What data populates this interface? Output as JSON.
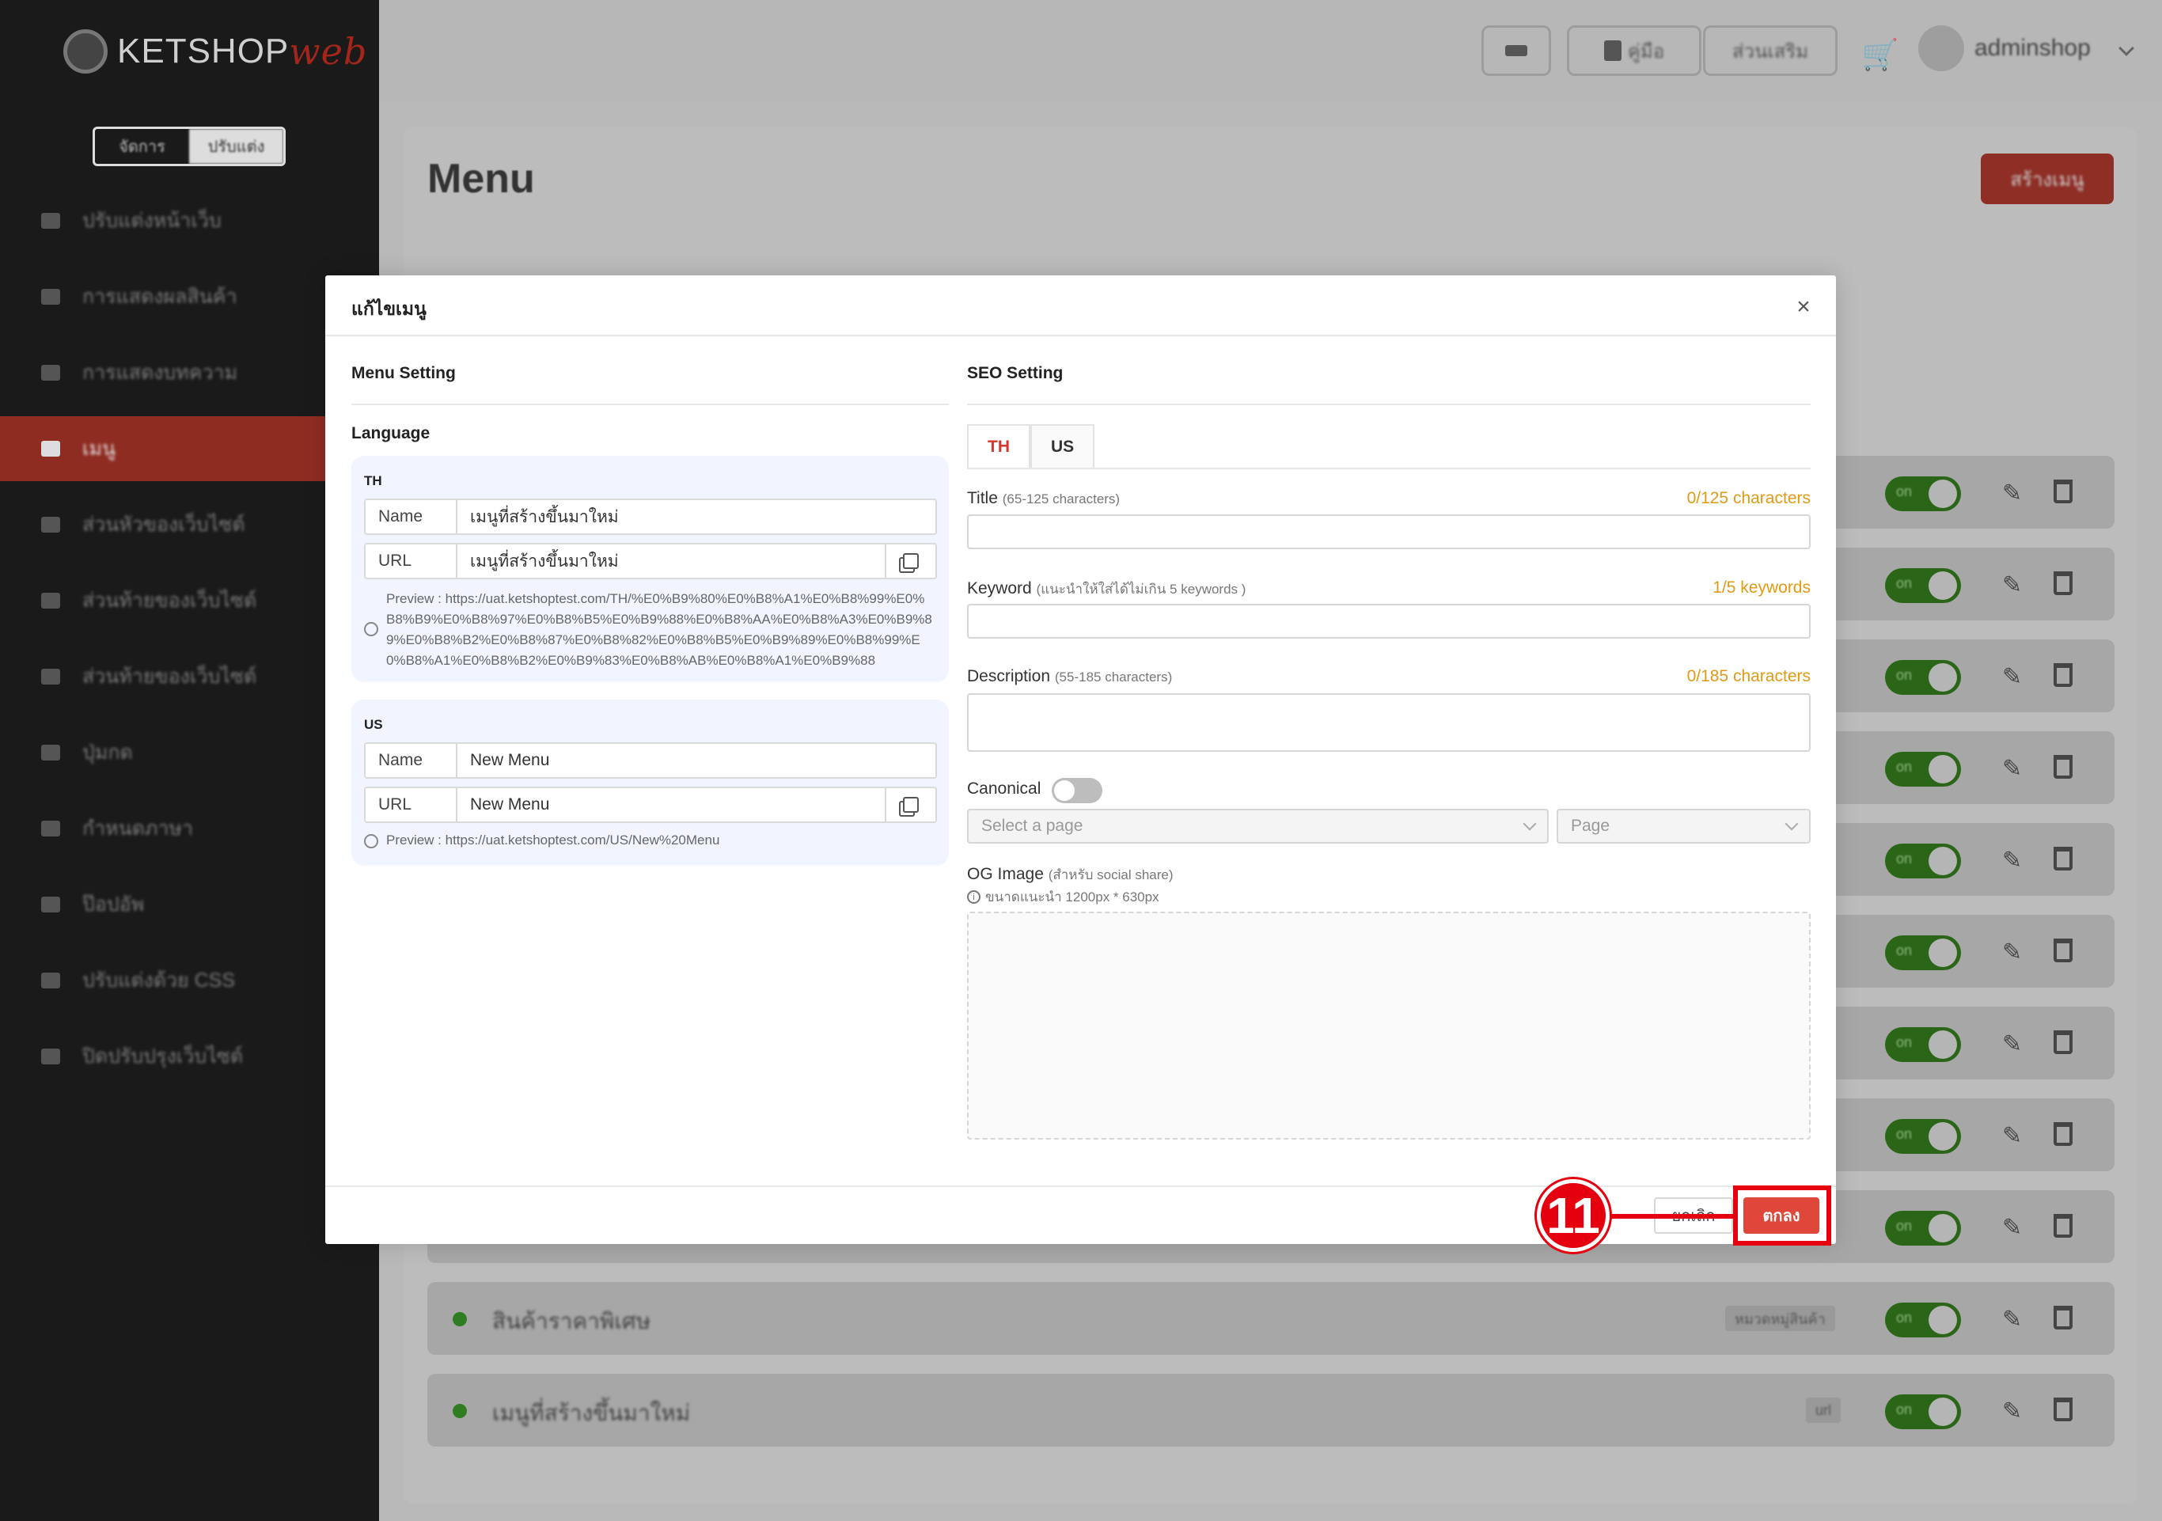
{
  "app": {
    "logo_text": "KETSHOP",
    "logo_suffix": "web"
  },
  "mode_switch": {
    "left": "จัดการ",
    "right": "ปรับแต่ง"
  },
  "sidebar": {
    "items": [
      {
        "label": "ปรับแต่งหน้าเว็บ",
        "icon": "layout-icon"
      },
      {
        "label": "การแสดงผลสินค้า",
        "icon": "product-grid-icon"
      },
      {
        "label": "การแสดงบทความ",
        "icon": "article-icon"
      },
      {
        "label": "เมนู",
        "icon": "menu-icon",
        "active": true
      },
      {
        "label": "ส่วนหัวของเว็บไซต์",
        "icon": "header-icon"
      },
      {
        "label": "ส่วนท้ายของเว็บไซต์",
        "icon": "footer-icon"
      },
      {
        "label": "ส่วนท้ายของเว็บไซต์",
        "icon": "sidebar-icon"
      },
      {
        "label": "ปุ่มกด",
        "icon": "button-icon"
      },
      {
        "label": "กำหนดภาษา",
        "icon": "language-icon"
      },
      {
        "label": "ป๊อปอัพ",
        "icon": "popup-icon"
      },
      {
        "label": "ปรับแต่งด้วย CSS",
        "icon": "css-icon"
      },
      {
        "label": "ปิดปรับปรุงเว็บไซต์",
        "icon": "maintenance-icon"
      }
    ]
  },
  "topbar": {
    "guide_label": "คู่มือ",
    "addon_label": "ส่วนเสริม",
    "username": "adminshop"
  },
  "page": {
    "title": "Menu",
    "create_button": "สร้างเมนู"
  },
  "background_rows": [
    {
      "label": "สินค้าราคาพิเศษ",
      "badge": "หมวดหมู่สินค้า",
      "toggle": "on"
    },
    {
      "label": "เมนูที่สร้างขึ้นมาใหม่",
      "badge": "url",
      "toggle": "on"
    }
  ],
  "bg_toggle_label": "on",
  "modal": {
    "title": "แก้ไขเมนู",
    "close_icon": "×",
    "menu_setting": {
      "heading": "Menu Setting",
      "language_label": "Language",
      "langs": [
        {
          "code": "TH",
          "name_label": "Name",
          "name_value": "เมนูที่สร้างขึ้นมาใหม่",
          "url_label": "URL",
          "url_value": "เมนูที่สร้างขึ้นมาใหม่",
          "preview": "Preview : https://uat.ketshoptest.com/TH/%E0%B9%80%E0%B8%A1%E0%B8%99%E0%B8%B9%E0%B8%97%E0%B8%B5%E0%B9%88%E0%B8%AA%E0%B8%A3%E0%B9%89%E0%B8%B2%E0%B8%87%E0%B8%82%E0%B8%B5%E0%B9%89%E0%B8%99%E0%B8%A1%E0%B8%B2%E0%B9%83%E0%B8%AB%E0%B8%A1%E0%B9%88"
        },
        {
          "code": "US",
          "name_label": "Name",
          "name_value": "New Menu",
          "url_label": "URL",
          "url_value": "New Menu",
          "preview": "Preview : https://uat.ketshoptest.com/US/New%20Menu"
        }
      ]
    },
    "seo_setting": {
      "heading": "SEO Setting",
      "tabs": [
        "TH",
        "US"
      ],
      "active_tab": "TH",
      "title_label": "Title",
      "title_hint": "(65-125 characters)",
      "title_counter": "0/125 characters",
      "keyword_label": "Keyword",
      "keyword_hint": "(แนะนำให้ใส่ได้ไม่เกิน 5 keywords )",
      "keyword_counter": "1/5 keywords",
      "description_label": "Description",
      "description_hint": "(55-185 characters)",
      "description_counter": "0/185 characters",
      "canonical_label": "Canonical",
      "select_page_placeholder": "Select a page",
      "page_placeholder": "Page",
      "og_label": "OG Image",
      "og_hint": "(สำหรับ social share)",
      "og_size_note": "ขนาดแนะนำ 1200px * 630px"
    },
    "footer": {
      "cancel_label": "ยกเลิก",
      "ok_label": "ตกลง"
    }
  },
  "annotation": {
    "step_number": "11",
    "color": "#e4000f"
  },
  "colors": {
    "brand_red": "#e0473b",
    "counter_orange": "#e09b16",
    "toggle_green": "#2a6518"
  }
}
